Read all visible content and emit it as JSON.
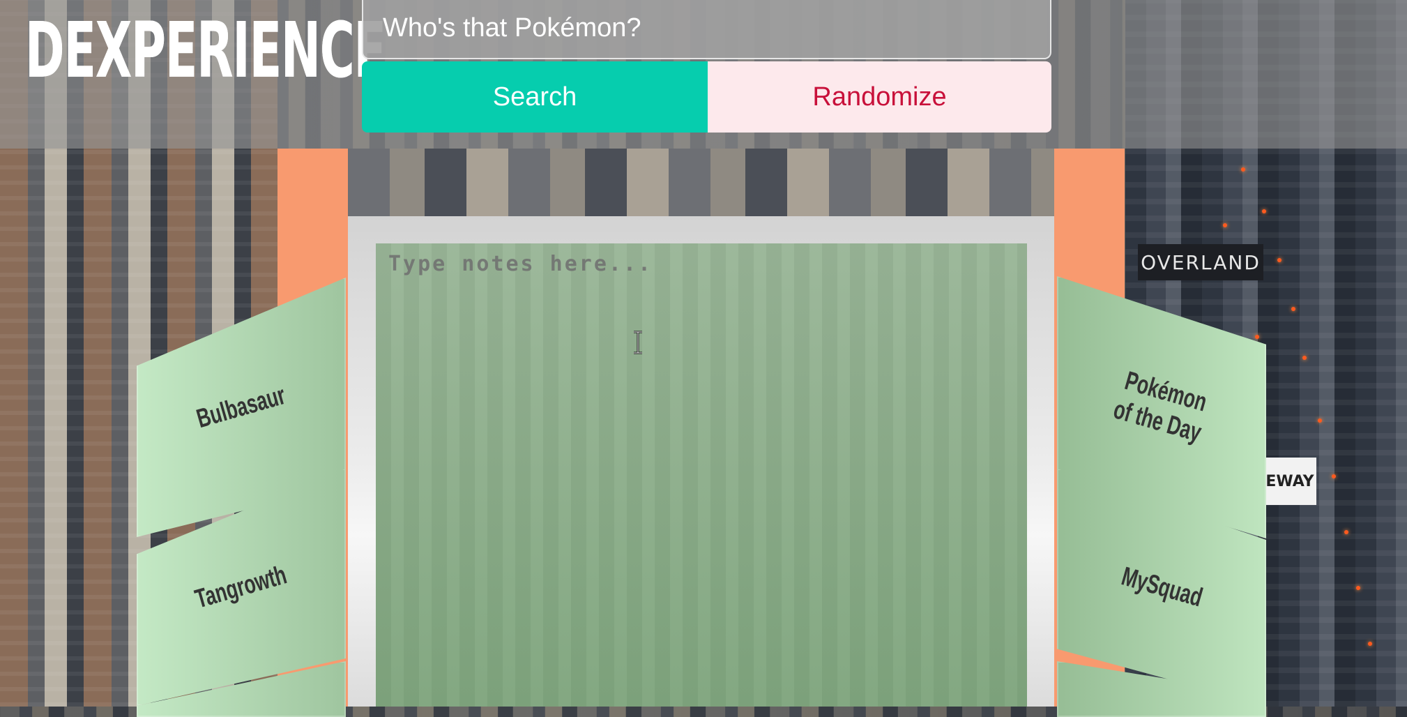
{
  "header": {
    "logo": "DEXPERIENCE",
    "search_placeholder": "Who's that Pokémon?",
    "search_button": "Search",
    "randomize_button": "Randomize"
  },
  "notes": {
    "placeholder": "Type notes here..."
  },
  "left_cards": [
    {
      "label": "Bulbasaur"
    },
    {
      "label": "Tangrowth"
    },
    {
      "label": ""
    }
  ],
  "right_cards": [
    {
      "label": "Pokémon\nof the Day"
    },
    {
      "label": "MySquad"
    },
    {
      "label": ""
    }
  ],
  "background_signs": {
    "overland": "OVERLAND",
    "eway": "EWAY"
  },
  "colors": {
    "search_button": "#06cdae",
    "randomize_button_bg": "#fde9ec",
    "randomize_button_text": "#c8103a",
    "panel_orange": "#f89a6f",
    "card_green": "#b4dcb4"
  }
}
